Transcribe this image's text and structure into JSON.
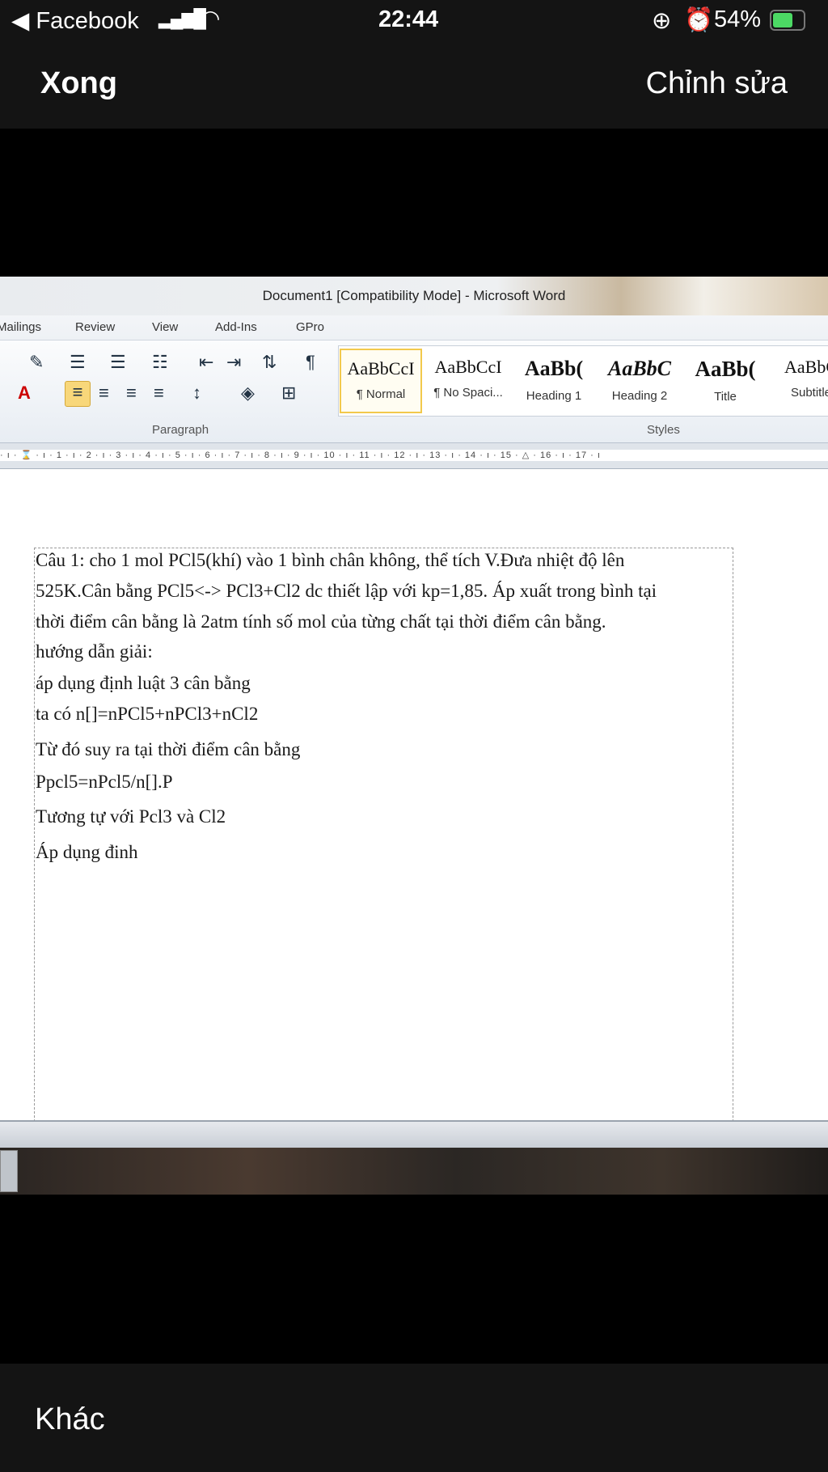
{
  "status_bar": {
    "back_app": "Facebook",
    "time": "22:44",
    "battery": "54%"
  },
  "nav": {
    "done": "Xong",
    "edit": "Chỉnh sửa"
  },
  "word": {
    "title": "Document1 [Compatibility Mode] - Microsoft Word",
    "tabs": [
      "Mailings",
      "Review",
      "View",
      "Add-Ins",
      "GPro"
    ],
    "groups": {
      "paragraph": "Paragraph",
      "styles": "Styles"
    },
    "styles": [
      {
        "preview": "AaBbCcI",
        "label": "¶ Normal"
      },
      {
        "preview": "AaBbCcI",
        "label": "¶ No Spaci..."
      },
      {
        "preview": "AaBb(",
        "label": "Heading 1"
      },
      {
        "preview": "AaBbC",
        "label": "Heading 2"
      },
      {
        "preview": "AaBb(",
        "label": "Title"
      },
      {
        "preview": "AaBbC",
        "label": "Subtitle"
      }
    ],
    "ruler": "· ı · ⌛ · ı · 1 · ı · 2 · ı · 3 · ı · 4 · ı · 5 · ı · 6 · ı · 7 · ı · 8 · ı · 9 · ı · 10 · ı · 11 · ı · 12 · ı · 13 · ı · 14 · ı · 15 · △ · 16 · ı · 17 · ı",
    "lines": [
      "Câu 1: cho 1 mol PCl5(khí) vào 1 bình chân không, thể tích V.Đưa  nhiệt độ lên",
      "525K.Cân bằng PCl5<-> PCl3+Cl2 dc thiết lập với kp=1,85. Áp xuất trong bình tại",
      "thời điểm cân bằng là 2atm tính số mol của từng chất tại thời điểm cân bằng.",
      "hướng dẫn giải:",
      "áp dụng định luật 3 cân bằng",
      "ta có n[]=nPCl5+nPCl3+nCl2",
      "Từ đó suy ra tại thời điểm cân bằng",
      "Ppcl5=nPcl5/n[].P",
      "Tương tự với Pcl3  và Cl2",
      "Áp dụng đinh"
    ]
  },
  "bottom": {
    "more": "Khác"
  }
}
